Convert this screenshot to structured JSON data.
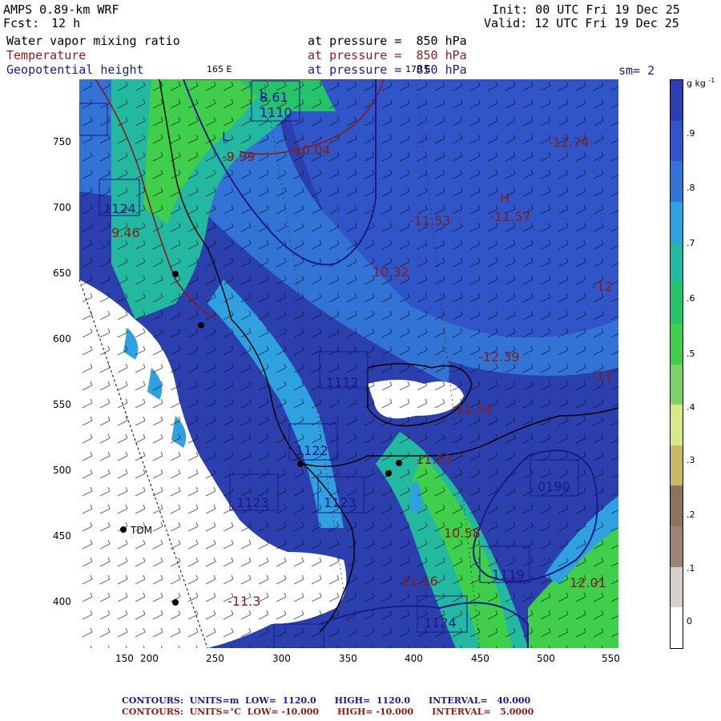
{
  "header": {
    "model": "AMPS 0.89-km WRF",
    "fcst_label": "Fcst:",
    "fcst_value": "12 h",
    "init": "Init: 00 UTC Fri 19 Dec 25",
    "valid": "Valid: 12 UTC Fri 19 Dec 25",
    "field1": "Water vapor mixing ratio",
    "field2": "Temperature",
    "field3": "Geopotential height",
    "level1": "at pressure =  850 hPa",
    "level2": "at pressure =  850 hPa",
    "level3": "at pressure =  850 hPa",
    "lon_label_left": "165 E",
    "lon_label_right": "170 E",
    "smoothing": "sm= 2"
  },
  "axes": {
    "x_ticks": [
      "150",
      "200",
      "250",
      "300",
      "350",
      "400",
      "450",
      "500",
      "550"
    ],
    "y_ticks": [
      "750",
      "700",
      "650",
      "600",
      "550",
      "500",
      "450",
      "400"
    ]
  },
  "colorbar": {
    "unit": "g kg",
    "unit_exp": "-1",
    "labels": [
      ".9",
      ".8",
      ".7",
      ".6",
      ".5",
      ".4",
      ".3",
      ".2",
      ".1",
      "0"
    ],
    "colors": [
      "#2c3fae",
      "#2f55c9",
      "#3274d6",
      "#2fa0e0",
      "#23b8a0",
      "#25c46a",
      "#3fcf4b",
      "#7fd36a",
      "#d9e986",
      "#c9b864",
      "#8d7359",
      "#9c8577",
      "#d6d0cc",
      "#ffffff"
    ]
  },
  "annotations": {
    "station": "TDM",
    "map_labels": [
      {
        "text": "L",
        "color": "blue"
      },
      {
        "text": "8.61",
        "color": "blue"
      },
      {
        "text": "1110",
        "color": "blue"
      },
      {
        "text": "L",
        "color": "blue"
      },
      {
        "text": "-9.99",
        "color": "red"
      },
      {
        "text": "-10.04",
        "color": "red"
      },
      {
        "text": "-12.74",
        "color": "red"
      },
      {
        "text": "-11.53",
        "color": "red"
      },
      {
        "text": "H",
        "color": "red"
      },
      {
        "text": "-11.57",
        "color": "red"
      },
      {
        "text": "10.32",
        "color": "red"
      },
      {
        "text": "-12",
        "color": "red"
      },
      {
        "text": "1124",
        "color": "blue"
      },
      {
        "text": "9.46",
        "color": "red"
      },
      {
        "text": "1112",
        "color": "blue"
      },
      {
        "text": "-12.39",
        "color": "red"
      },
      {
        "text": "-11",
        "color": "red"
      },
      {
        "text": "11.54",
        "color": "red"
      },
      {
        "text": "1122",
        "color": "blue"
      },
      {
        "text": "11.03",
        "color": "red"
      },
      {
        "text": "1123",
        "color": "blue"
      },
      {
        "text": "1123",
        "color": "blue"
      },
      {
        "text": "0190",
        "color": "blue"
      },
      {
        "text": "10.58",
        "color": "red"
      },
      {
        "text": "1119",
        "color": "blue"
      },
      {
        "text": "11.16",
        "color": "red"
      },
      {
        "text": "12.01",
        "color": "red"
      },
      {
        "text": "1124",
        "color": "blue"
      },
      {
        "text": "-11.3",
        "color": "red"
      }
    ]
  },
  "footer": {
    "line1_label": "CONTOURS:",
    "line1_units": "UNITS=m",
    "line1_low": "LOW=  1120.0",
    "line1_high": "HIGH=  1120.0",
    "line1_interval": "INTERVAL=   40.000",
    "line2_label": "CONTOURS:",
    "line2_units": "UNITS=°C",
    "line2_low": "LOW= -10.000",
    "line2_high": "HIGH= -10.000",
    "line2_interval": "INTERVAL=   5.0000"
  }
}
